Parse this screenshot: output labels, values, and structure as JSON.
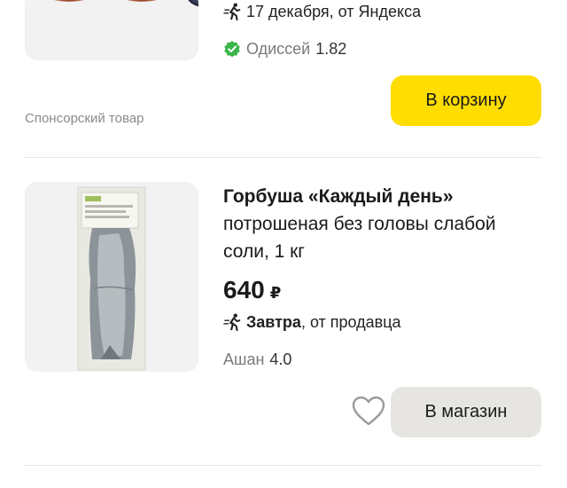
{
  "top_product": {
    "delivery_text": "17 декабря, от Яндекса",
    "seller": "Одиссей",
    "rating": "1.82",
    "cart_button": "В корзину",
    "sponsored_label": "Спонсорский товар"
  },
  "product": {
    "title_brand": "Горбуша «Каждый день»",
    "title_rest": "потрошеная без головы слабой соли, 1 кг",
    "price": "640",
    "currency": "₽",
    "delivery_day": "Завтра",
    "delivery_from": ", от продавца",
    "seller": "Ашан",
    "rating": "4.0",
    "shop_button": "В магазин"
  },
  "icons": {
    "delivery": "running-person-icon",
    "verified": "verified-badge-icon",
    "favorite": "heart-icon"
  },
  "colors": {
    "cart_button": "#ffdd00",
    "shop_button": "#e6e5e1",
    "verified_badge": "#3bb54a"
  }
}
